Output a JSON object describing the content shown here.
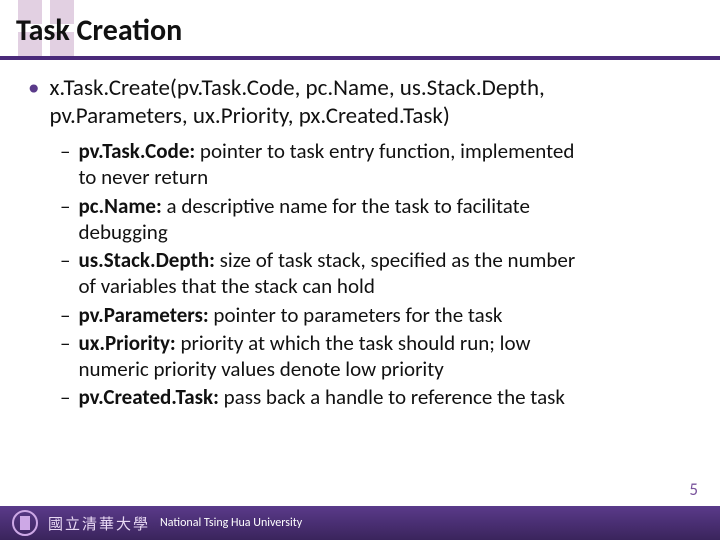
{
  "title": "Task Creation",
  "main": {
    "line1": "x.Task.Create(pv.Task.Code, pc.Name, us.Stack.Depth,",
    "line2": "pv.Parameters, ux.Priority, px.Created.Task)"
  },
  "params": [
    {
      "name": "pv.Task.Code:",
      "desc_a": " pointer to task entry function, implemented",
      "desc_b": "to never return"
    },
    {
      "name": "pc.Name:",
      "desc_a": " a descriptive name for the task to facilitate",
      "desc_b": "debugging"
    },
    {
      "name": "us.Stack.Depth:",
      "desc_a": " size of task stack, specified as the number",
      "desc_b": "of variables that the stack can hold"
    },
    {
      "name": "pv.Parameters:",
      "desc_a": " pointer to parameters for the task",
      "desc_b": ""
    },
    {
      "name": "ux.Priority:",
      "desc_a": " priority at which the task should run; low",
      "desc_b": "numeric priority values denote low priority"
    },
    {
      "name": "pv.Created.Task:",
      "desc_a": " pass back a handle to reference the task",
      "desc_b": ""
    }
  ],
  "footer": {
    "uni_cn": "國立清華大學",
    "uni_en": "National Tsing Hua University"
  },
  "page_number": "5"
}
